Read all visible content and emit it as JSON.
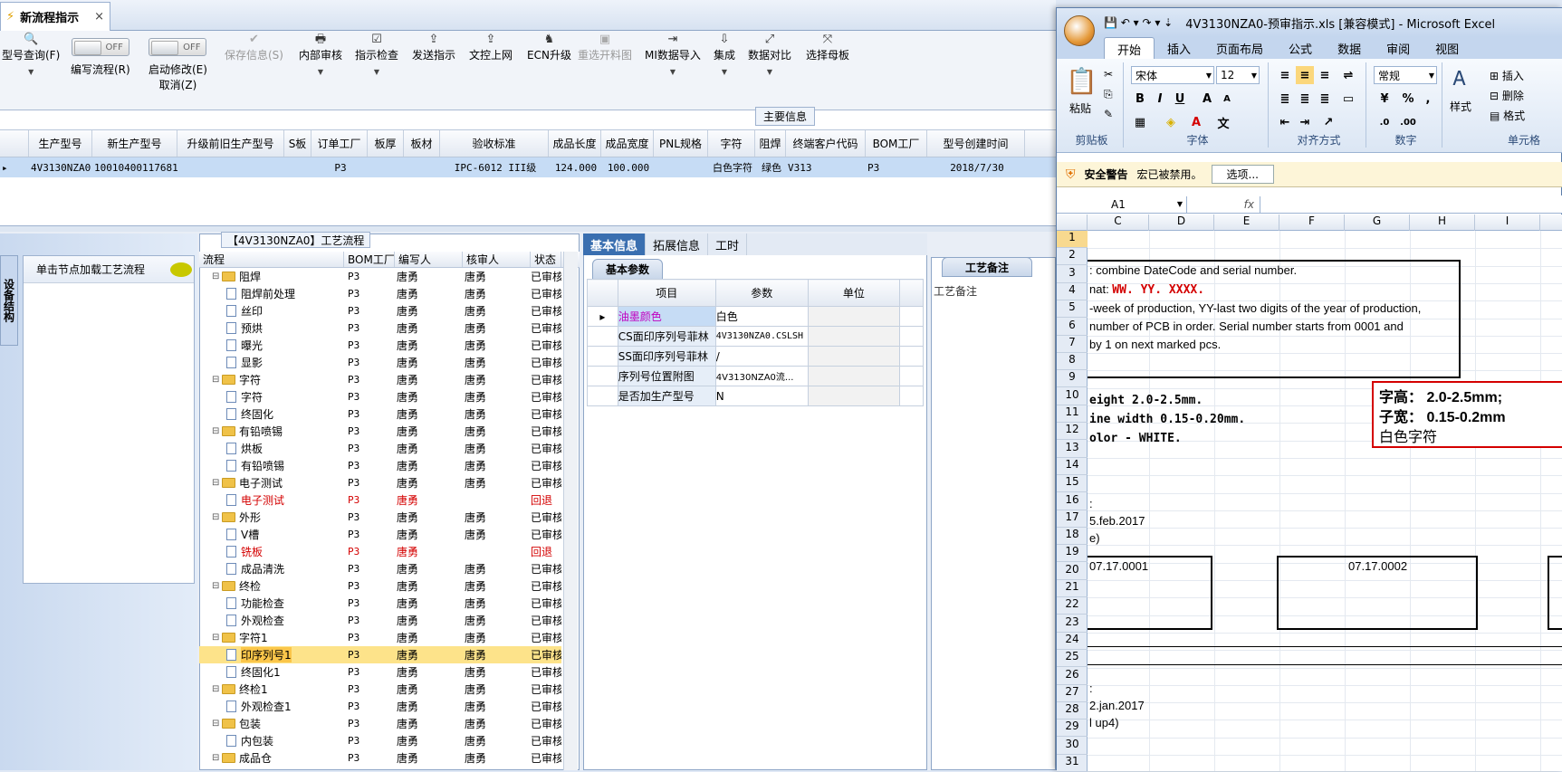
{
  "app": {
    "tab_title": "新流程指示",
    "tab_close": "×",
    "toolbar": [
      {
        "label": "型号查询(F)",
        "icon": "🔍",
        "disabled": false
      },
      {
        "label": "编写流程(R)",
        "toggle": "OFF",
        "disabled": false
      },
      {
        "label": "启动修改(E)",
        "sub": "取消(Z)",
        "toggle": "OFF",
        "disabled": false
      },
      {
        "label": "保存信息(S)",
        "icon": "✔",
        "disabled": true
      },
      {
        "label": "内部审核",
        "icon": "🖶",
        "disabled": false
      },
      {
        "label": "指示检查",
        "icon": "☑",
        "disabled": false
      },
      {
        "label": "发送指示",
        "icon": "⇪",
        "disabled": false
      },
      {
        "label": "文控上网",
        "icon": "⇪",
        "disabled": false
      },
      {
        "label": "ECN升级",
        "icon": "♞",
        "disabled": false
      },
      {
        "label": "重选开料图",
        "icon": "▣",
        "disabled": true
      },
      {
        "label": "MI数据导入",
        "icon": "⇥",
        "disabled": false
      },
      {
        "label": "集成",
        "icon": "⇩",
        "disabled": false
      },
      {
        "label": "数据对比",
        "icon": "⤢",
        "disabled": false
      },
      {
        "label": "选择母板",
        "icon": "⤧",
        "disabled": false
      }
    ],
    "main_section_title": "主要信息",
    "grid_columns": [
      "生产型号",
      "新生产型号",
      "升级前旧生产型号",
      "S板",
      "订单工厂",
      "板厚",
      "板材",
      "验收标准",
      "成品长度",
      "成品宽度",
      "PNL规格",
      "字符",
      "阻焊",
      "终端客户代码",
      "BOM工厂",
      "型号创建时间"
    ],
    "grid_row": [
      "4V3130NZA0",
      "10010400117681",
      "",
      "",
      "P3",
      "",
      "",
      "IPC-6012 III级",
      "124.000",
      "100.000",
      "",
      "白色字符",
      "绿色",
      "V313",
      "P3",
      "2018/7/30"
    ],
    "left_vtab": "设备结构",
    "node_hint": "单击节点加载工艺流程",
    "tree_title": "【4V3130NZA0】工艺流程",
    "tree_columns": [
      "流程",
      "BOM工厂",
      "编写人",
      "核审人",
      "状态"
    ],
    "tree_rows": [
      {
        "level": 1,
        "name": "阻焊",
        "bom": "P3",
        "writer": "唐勇",
        "reviewer": "唐勇",
        "status": "已审核"
      },
      {
        "level": 2,
        "name": "阻焊前处理",
        "bom": "P3",
        "writer": "唐勇",
        "reviewer": "唐勇",
        "status": "已审核"
      },
      {
        "level": 2,
        "name": "丝印",
        "bom": "P3",
        "writer": "唐勇",
        "reviewer": "唐勇",
        "status": "已审核"
      },
      {
        "level": 2,
        "name": "预烘",
        "bom": "P3",
        "writer": "唐勇",
        "reviewer": "唐勇",
        "status": "已审核"
      },
      {
        "level": 2,
        "name": "曝光",
        "bom": "P3",
        "writer": "唐勇",
        "reviewer": "唐勇",
        "status": "已审核"
      },
      {
        "level": 2,
        "name": "显影",
        "bom": "P3",
        "writer": "唐勇",
        "reviewer": "唐勇",
        "status": "已审核"
      },
      {
        "level": 1,
        "name": "字符",
        "bom": "P3",
        "writer": "唐勇",
        "reviewer": "唐勇",
        "status": "已审核"
      },
      {
        "level": 2,
        "name": "字符",
        "bom": "P3",
        "writer": "唐勇",
        "reviewer": "唐勇",
        "status": "已审核"
      },
      {
        "level": 2,
        "name": "终固化",
        "bom": "P3",
        "writer": "唐勇",
        "reviewer": "唐勇",
        "status": "已审核"
      },
      {
        "level": 1,
        "name": "有铅喷锡",
        "bom": "P3",
        "writer": "唐勇",
        "reviewer": "唐勇",
        "status": "已审核"
      },
      {
        "level": 2,
        "name": "烘板",
        "bom": "P3",
        "writer": "唐勇",
        "reviewer": "唐勇",
        "status": "已审核"
      },
      {
        "level": 2,
        "name": "有铅喷锡",
        "bom": "P3",
        "writer": "唐勇",
        "reviewer": "唐勇",
        "status": "已审核"
      },
      {
        "level": 1,
        "name": "电子测试",
        "bom": "P3",
        "writer": "唐勇",
        "reviewer": "唐勇",
        "status": "已审核"
      },
      {
        "level": 2,
        "name": "电子测试",
        "bom": "P3",
        "writer": "唐勇",
        "reviewer": "",
        "status": "回退",
        "red": true
      },
      {
        "level": 1,
        "name": "外形",
        "bom": "P3",
        "writer": "唐勇",
        "reviewer": "唐勇",
        "status": "已审核"
      },
      {
        "level": 2,
        "name": "V槽",
        "bom": "P3",
        "writer": "唐勇",
        "reviewer": "唐勇",
        "status": "已审核"
      },
      {
        "level": 2,
        "name": "铣板",
        "bom": "P3",
        "writer": "唐勇",
        "reviewer": "",
        "status": "回退",
        "red": true
      },
      {
        "level": 2,
        "name": "成品清洗",
        "bom": "P3",
        "writer": "唐勇",
        "reviewer": "唐勇",
        "status": "已审核"
      },
      {
        "level": 1,
        "name": "终检",
        "bom": "P3",
        "writer": "唐勇",
        "reviewer": "唐勇",
        "status": "已审核"
      },
      {
        "level": 2,
        "name": "功能检查",
        "bom": "P3",
        "writer": "唐勇",
        "reviewer": "唐勇",
        "status": "已审核"
      },
      {
        "level": 2,
        "name": "外观检查",
        "bom": "P3",
        "writer": "唐勇",
        "reviewer": "唐勇",
        "status": "已审核"
      },
      {
        "level": 1,
        "name": "字符1",
        "bom": "P3",
        "writer": "唐勇",
        "reviewer": "唐勇",
        "status": "已审核"
      },
      {
        "level": 2,
        "name": "印序列号1",
        "bom": "P3",
        "writer": "唐勇",
        "reviewer": "唐勇",
        "status": "已审核",
        "selected": true
      },
      {
        "level": 2,
        "name": "终固化1",
        "bom": "P3",
        "writer": "唐勇",
        "reviewer": "唐勇",
        "status": "已审核"
      },
      {
        "level": 1,
        "name": "终检1",
        "bom": "P3",
        "writer": "唐勇",
        "reviewer": "唐勇",
        "status": "已审核"
      },
      {
        "level": 2,
        "name": "外观检查1",
        "bom": "P3",
        "writer": "唐勇",
        "reviewer": "唐勇",
        "status": "已审核"
      },
      {
        "level": 1,
        "name": "包装",
        "bom": "P3",
        "writer": "唐勇",
        "reviewer": "唐勇",
        "status": "已审核"
      },
      {
        "level": 2,
        "name": "内包装",
        "bom": "P3",
        "writer": "唐勇",
        "reviewer": "唐勇",
        "status": "已审核"
      },
      {
        "level": 1,
        "name": "成品仓",
        "bom": "P3",
        "writer": "唐勇",
        "reviewer": "唐勇",
        "status": "已审核"
      }
    ],
    "detail_tabs": [
      "基本信息",
      "拓展信息",
      "工时"
    ],
    "basic_title": "基本参数",
    "param_columns": [
      "项目",
      "参数",
      "单位"
    ],
    "params": [
      {
        "item": "油墨颜色",
        "value": "白色",
        "unit": "",
        "highlight": true
      },
      {
        "item": "CS面印序列号菲林",
        "value": "4V3130NZA0.CSLSH",
        "unit": ""
      },
      {
        "item": "SS面印序列号菲林",
        "value": "/",
        "unit": ""
      },
      {
        "item": "序列号位置附图",
        "value": "4V3130NZA0流...",
        "unit": ""
      },
      {
        "item": "是否加生产型号",
        "value": "N",
        "unit": ""
      }
    ],
    "remark_tab": "工艺备注",
    "remark_label": "工艺备注"
  },
  "excel": {
    "title": "4V3130NZA0-预审指示.xls [兼容模式] - Microsoft Excel",
    "tabs": [
      "开始",
      "插入",
      "页面布局",
      "公式",
      "数据",
      "审阅",
      "视图"
    ],
    "groups": [
      "剪贴板",
      "字体",
      "对齐方式",
      "数字",
      "单元格"
    ],
    "paste": "粘贴",
    "font_name": "宋体",
    "font_size": "12",
    "number_format": "常规",
    "style": "样式",
    "insert": "插入",
    "delete": "删除",
    "format": "格式",
    "security_label": "安全警告",
    "security_msg": "宏已被禁用。",
    "options_btn": "选项...",
    "name_box": "A1",
    "fx": "fx",
    "columns": [
      "C",
      "D",
      "E",
      "F",
      "G",
      "H",
      "I"
    ],
    "rows": [
      "1",
      "2",
      "3",
      "4",
      "5",
      "6",
      "7",
      "8",
      "9",
      "10",
      "11",
      "12",
      "13",
      "14",
      "15",
      "16",
      "17",
      "18",
      "19",
      "20",
      "21",
      "22",
      "23",
      "24",
      "25",
      "26",
      "27",
      "28",
      "29",
      "30",
      "31"
    ],
    "text": {
      "r3": ": combine DateCode and serial number.",
      "r4a": "nat: ",
      "r4b": "WW. YY. XXXX.",
      "r5": "-week of production, YY-last two digits of the year of production,",
      "r6": "number of PCB in order. Serial number starts from 0001 and",
      "r7": "by 1 on next marked pcs.",
      "r11": "eight 2.0-2.5mm.",
      "r12": "ine width 0.15-0.20mm.",
      "r13": "olor - WHITE.",
      "note1": "字高：  2.0-2.5mm;",
      "note2": "子宽：  0.15-0.2mm",
      "note3": "白色字符",
      "r18": ":",
      "r19": "5.feb.2017",
      "r20": "e)",
      "box1": "07.17.0001",
      "box2": "07.17.0002",
      "r29": ":",
      "r30": "2.jan.2017",
      "r31": "l up4)"
    }
  }
}
